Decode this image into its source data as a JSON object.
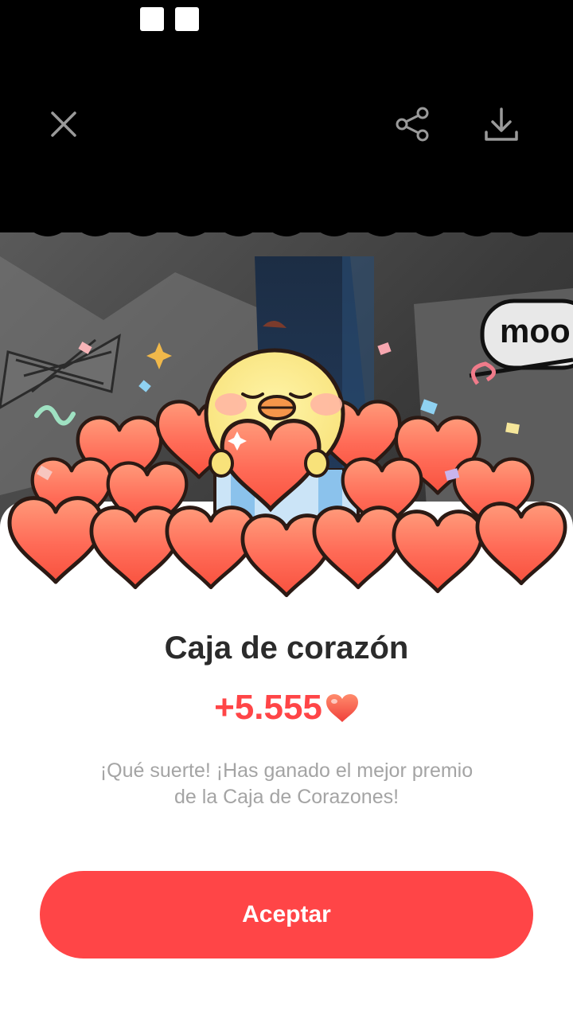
{
  "top_bar": {
    "close_icon": "close-icon",
    "share_icon": "share-icon",
    "download_icon": "download-icon"
  },
  "background": {
    "sign_text": "moo"
  },
  "card": {
    "title": "Caja de corazón",
    "amount": "+5.555",
    "description": "¡Qué suerte! ¡Has ganado el mejor premio de la Caja de Corazones!",
    "accept_label": "Aceptar"
  },
  "colors": {
    "accent": "#ff4547",
    "title": "#2b2b2b",
    "description": "#a4a4a4"
  }
}
